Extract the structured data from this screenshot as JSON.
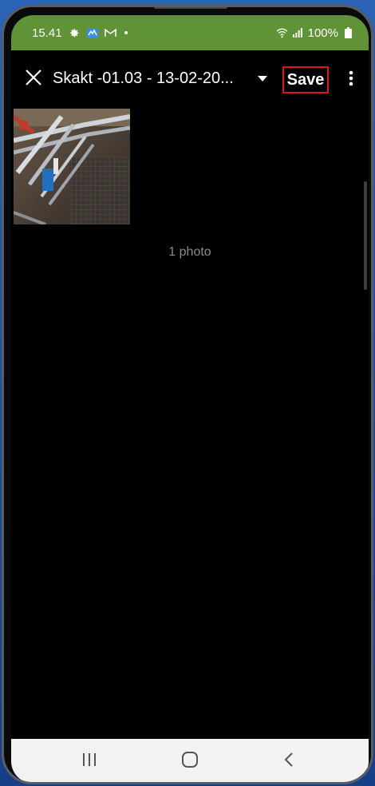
{
  "status_bar": {
    "time": "15.41",
    "battery": "100%",
    "icons": [
      "settings-icon",
      "app-badge-icon",
      "gmail-icon",
      "notification-dot-icon",
      "wifi-icon",
      "signal-icon",
      "battery-icon"
    ]
  },
  "toolbar": {
    "close_icon": "close-icon",
    "album_title": "Skakt -01.03 - 13-02-20...",
    "dropdown_icon": "caret-down-icon",
    "save_label": "Save",
    "more_icon": "more-vertical-icon",
    "save_highlight_color": "#e0151b"
  },
  "gallery": {
    "photos": [
      {
        "type": "photo",
        "subject": "pipes"
      }
    ],
    "count_label": "1 photo"
  },
  "nav_bar": {
    "recent_icon": "recent-apps-icon",
    "home_icon": "home-icon",
    "back_icon": "back-icon"
  },
  "colors": {
    "status_bar": "#5f9335",
    "background": "#000000",
    "nav_bar": "#f2f2f2",
    "count_text": "#8a8a8a"
  }
}
